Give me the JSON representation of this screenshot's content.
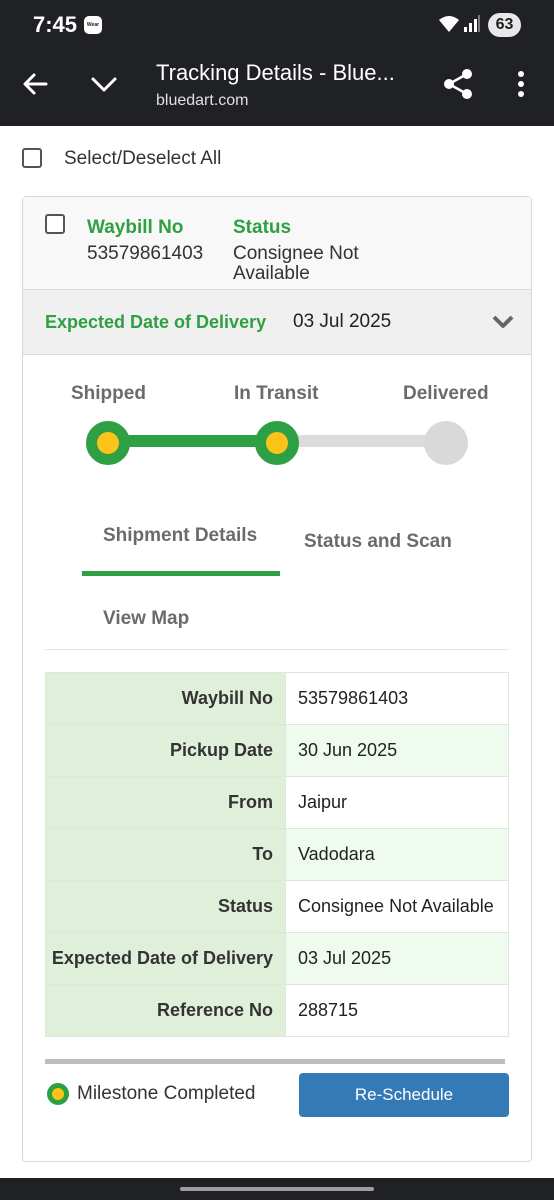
{
  "status_bar": {
    "time": "7:45",
    "wear_badge": "Wear",
    "battery": "63"
  },
  "toolbar": {
    "title": "Tracking Details - Blue...",
    "url": "bluedart.com"
  },
  "select_all": {
    "label": "Select/Deselect All"
  },
  "shipment": {
    "waybill_label": "Waybill No",
    "waybill_value": "53579861403",
    "status_label": "Status",
    "status_value_line1": "Consignee Not",
    "status_value_line2": "Available",
    "edd_label": "Expected Date of Delivery",
    "edd_value": "03 Jul 2025"
  },
  "progress": {
    "steps": [
      "Shipped",
      "In Transit",
      "Delivered"
    ],
    "completed_steps": 2
  },
  "tabs": [
    "Shipment Details",
    "Status and Scan",
    "View Map"
  ],
  "details": [
    {
      "key": "Waybill No",
      "value": "53579861403"
    },
    {
      "key": "Pickup Date",
      "value": "30 Jun 2025"
    },
    {
      "key": "From",
      "value": "Jaipur"
    },
    {
      "key": "To",
      "value": "Vadodara"
    },
    {
      "key": "Status",
      "value": "Consignee Not Available"
    },
    {
      "key": "Expected Date of Delivery",
      "value": "03 Jul 2025"
    },
    {
      "key": "Reference No",
      "value": "288715"
    }
  ],
  "legend": {
    "label": "Milestone Completed"
  },
  "actions": {
    "reschedule": "Re-Schedule"
  },
  "colors": {
    "accent_green": "#2ea043",
    "milestone_yellow": "#fcc419",
    "button_blue": "#337ab7",
    "toolbar_dark": "#202124"
  }
}
